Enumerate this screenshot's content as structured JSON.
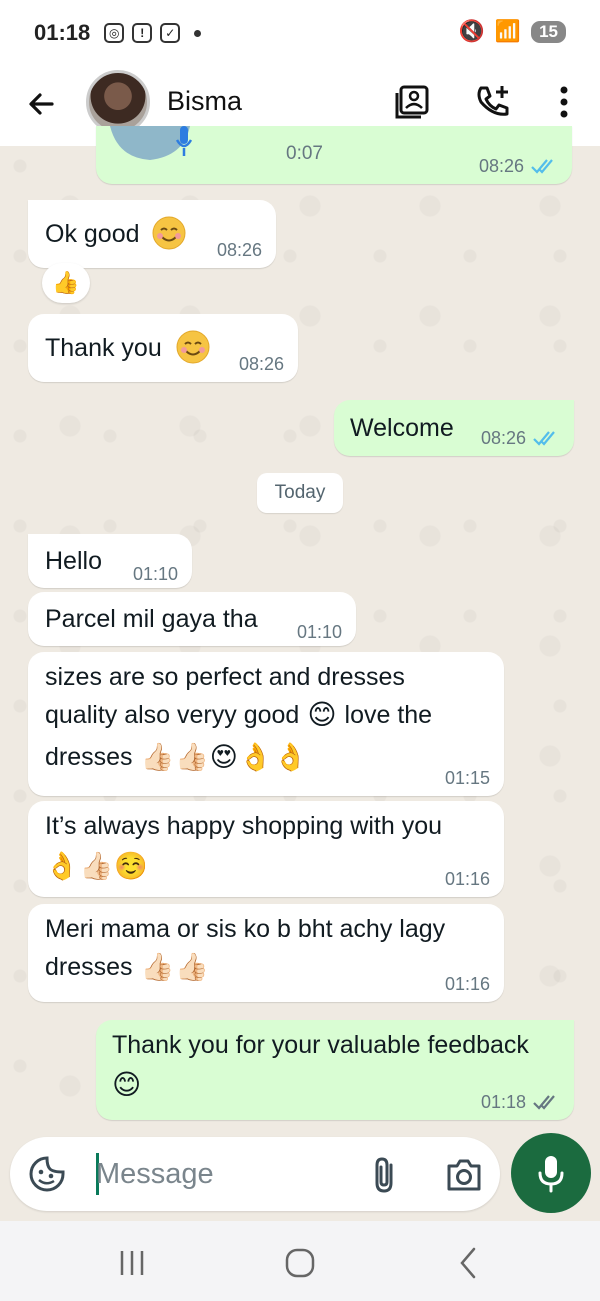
{
  "status_bar": {
    "time": "01:18",
    "battery": "15"
  },
  "header": {
    "contact_name": "Bisma"
  },
  "voice_note": {
    "duration": "0:07",
    "time": "08:26"
  },
  "date_separator": "Today",
  "messages": [
    {
      "dir": "in",
      "text": "Ok good",
      "time": "08:26",
      "reaction": "thumbs-up"
    },
    {
      "dir": "in",
      "text": "Thank you",
      "time": "08:26"
    },
    {
      "dir": "out",
      "text": "Welcome",
      "time": "08:26"
    },
    {
      "dir": "in",
      "text": "Hello",
      "time": "01:10"
    },
    {
      "dir": "in",
      "text": "Parcel mil gaya tha",
      "time": "01:10"
    },
    {
      "dir": "in",
      "text_1": "sizes are so perfect and dresses",
      "text_2": "quality also veryy good",
      "text_3": "love the",
      "text_4": "dresses",
      "time": "01:15"
    },
    {
      "dir": "in",
      "text": "It’s always happy shopping with you",
      "time": "01:16"
    },
    {
      "dir": "in",
      "text_1": "Meri mama or sis ko b bht achy lagy",
      "text_2": "dresses",
      "time": "01:16"
    },
    {
      "dir": "out",
      "text": "Thank you for your valuable feedback",
      "time": "01:18"
    }
  ],
  "composer": {
    "placeholder": "Message"
  },
  "colors": {
    "incoming": "#ffffff",
    "outgoing": "#d9fdd3",
    "mic_button": "#1b6b3f",
    "tick_blue": "#53bdeb",
    "tick_grey": "#667781"
  }
}
